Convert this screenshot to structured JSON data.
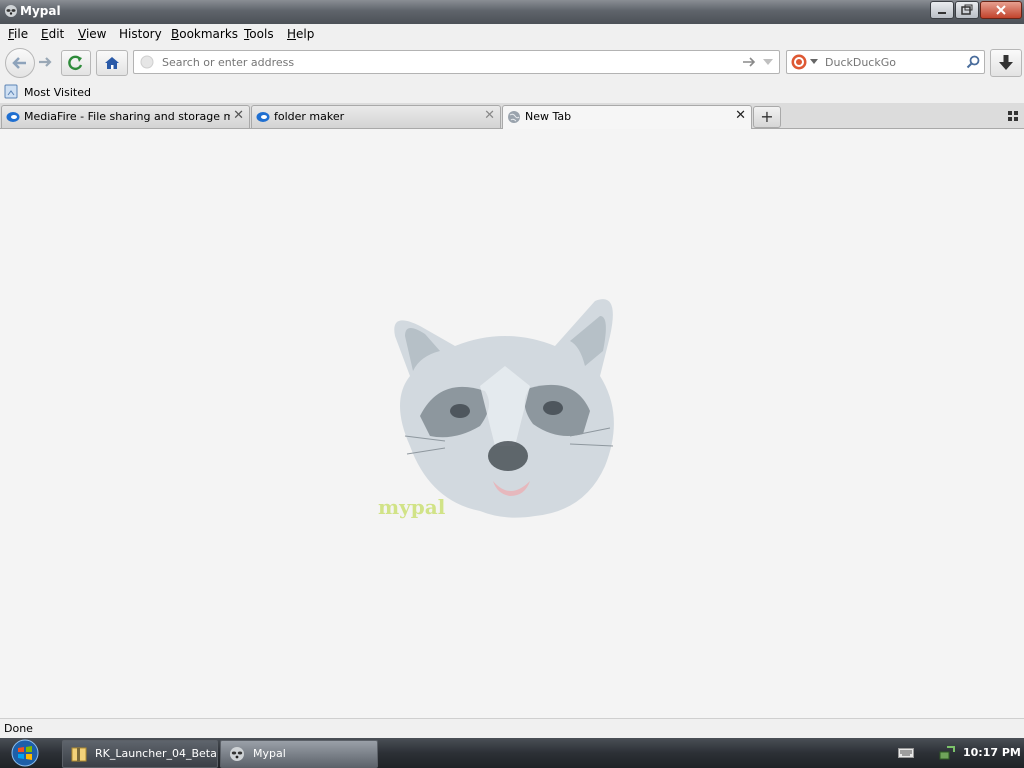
{
  "window": {
    "title": "Mypal",
    "icon": "raccoon-icon"
  },
  "menu": [
    {
      "label": "File",
      "accel": "F",
      "rest": "ile"
    },
    {
      "label": "Edit",
      "accel": "E",
      "rest": "dit"
    },
    {
      "label": "View",
      "accel": "V",
      "rest": "iew"
    },
    {
      "label": "History",
      "accel": "",
      "rest": "History"
    },
    {
      "label": "Bookmarks",
      "accel": "B",
      "rest": "ookmarks"
    },
    {
      "label": "Tools",
      "accel": "T",
      "rest": "ools"
    },
    {
      "label": "Help",
      "accel": "H",
      "rest": "elp"
    }
  ],
  "navbar": {
    "url_placeholder": "Search or enter address",
    "search_placeholder": "DuckDuckGo",
    "search_engine_icon": "duckduckgo-icon"
  },
  "bookmarks": [
    {
      "label": "Most Visited",
      "icon": "bookmark-folder-icon"
    }
  ],
  "tabs": [
    {
      "label": "MediaFire - File sharing and storage m...",
      "icon": "mediafire-icon",
      "active": false
    },
    {
      "label": "folder maker",
      "icon": "mediafire-icon",
      "active": false
    },
    {
      "label": "New Tab",
      "icon": "globe-icon",
      "active": true
    }
  ],
  "content": {
    "logo_text": "mypal",
    "logo": "raccoon-face"
  },
  "status": {
    "text": "Done"
  },
  "taskbar": {
    "items": [
      {
        "label": "RK_Launcher_04_Beta",
        "icon": "folder-zip-icon",
        "active": false
      },
      {
        "label": "Mypal",
        "icon": "raccoon-icon",
        "active": true
      }
    ],
    "clock": "10:17 PM"
  },
  "colors": {
    "title_bar": "#5f646b",
    "taskbar": "#2c3036",
    "accent": "#1f6fd1"
  }
}
